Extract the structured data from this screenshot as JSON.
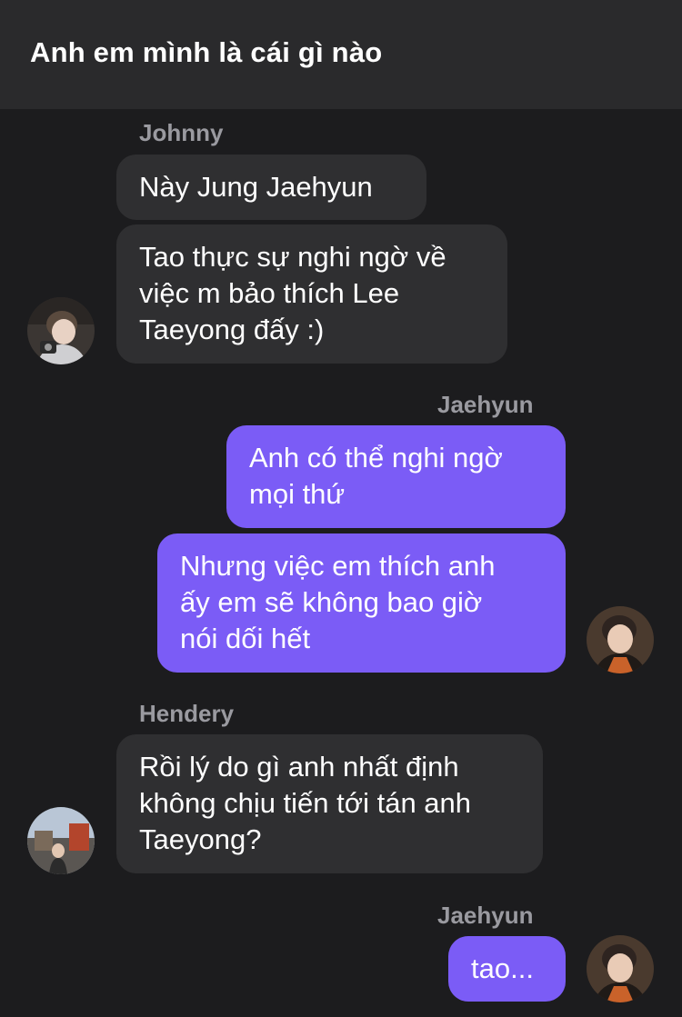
{
  "header": {
    "title": "Anh em mình là cái gì nào"
  },
  "messages": [
    {
      "sender": "Johnny",
      "bubbles": [
        "Này Jung Jaehyun",
        "Tao thực sự nghi ngờ về\nviệc m bảo thích Lee\nTaeyong đấy :)"
      ]
    },
    {
      "sender": "Jaehyun",
      "bubbles": [
        "Anh có thể nghi ngờ\nmọi thứ",
        "Nhưng việc em thích anh\nấy em sẽ không bao giờ\nnói dối hết"
      ]
    },
    {
      "sender": "Hendery",
      "bubbles": [
        "Rồi lý do gì anh nhất định\nkhông chịu tiến tới tán anh\nTaeyong?"
      ]
    },
    {
      "sender": "Jaehyun",
      "bubbles": [
        "tao..."
      ]
    }
  ],
  "colors": {
    "background": "#1c1c1e",
    "header": "#2a2a2c",
    "incoming_bubble": "#2f2f31",
    "outgoing_bubble": "#7b5cf6",
    "sender_name": "#9a9aa0"
  }
}
